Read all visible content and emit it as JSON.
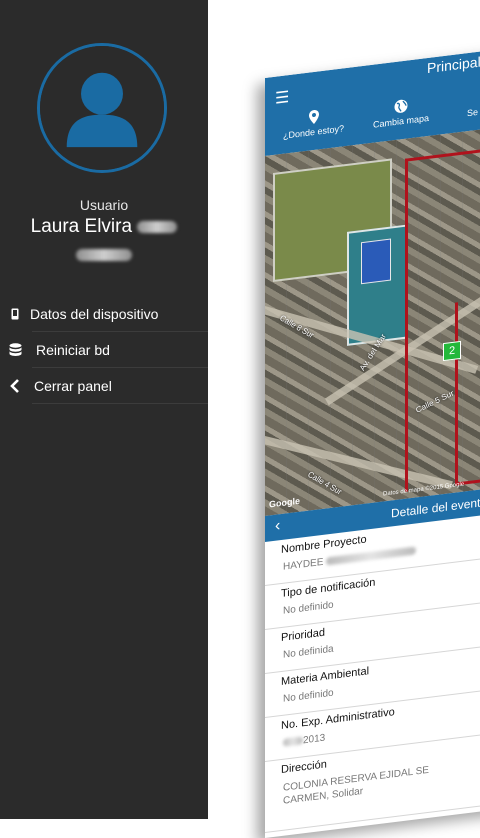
{
  "panel": {
    "user_role": "Usuario",
    "user_name": "Laura Elvira",
    "menu": [
      {
        "label": "Datos del dispositivo",
        "icon": "phone-icon"
      },
      {
        "label": "Reiniciar bd",
        "icon": "database-icon"
      },
      {
        "label": "Cerrar panel",
        "icon": "chevron-left-icon"
      }
    ]
  },
  "phone": {
    "title": "Principal",
    "nav": [
      {
        "label": "¿Donde estoy?",
        "icon": "location-pin-icon"
      },
      {
        "label": "Cambia mapa",
        "icon": "globe-icon"
      },
      {
        "label": "Se",
        "icon": "other-icon"
      }
    ],
    "map": {
      "marker_count": "2",
      "streets": [
        "Calle 8 Sur",
        "Calle 5 Sur",
        "Av. del Mar",
        "Calle 4 Sur",
        "Calle 5 Sur"
      ],
      "credits": "Datos de mapa ©2015 Google",
      "google": "Google"
    },
    "detail_title": "Detalle del event",
    "fields": [
      {
        "label": "Nombre Proyecto",
        "value": "HAYDEE"
      },
      {
        "label": "Tipo de notificación",
        "value": "No definido"
      },
      {
        "label": "Prioridad",
        "value": "No definida"
      },
      {
        "label": "Materia Ambiental",
        "value": "No definido"
      },
      {
        "label": "No. Exp. Administrativo",
        "value": "2013"
      },
      {
        "label": "Dirección",
        "value": "COLONIA RESERVA EJIDAL SE CARMEN, Solidar"
      }
    ]
  },
  "colors": {
    "panel_bg": "#2b2b2b",
    "accent": "#1f6fa8",
    "avatar": "#1a6ba3",
    "route": "#b0121c",
    "marker": "#23b83a"
  }
}
